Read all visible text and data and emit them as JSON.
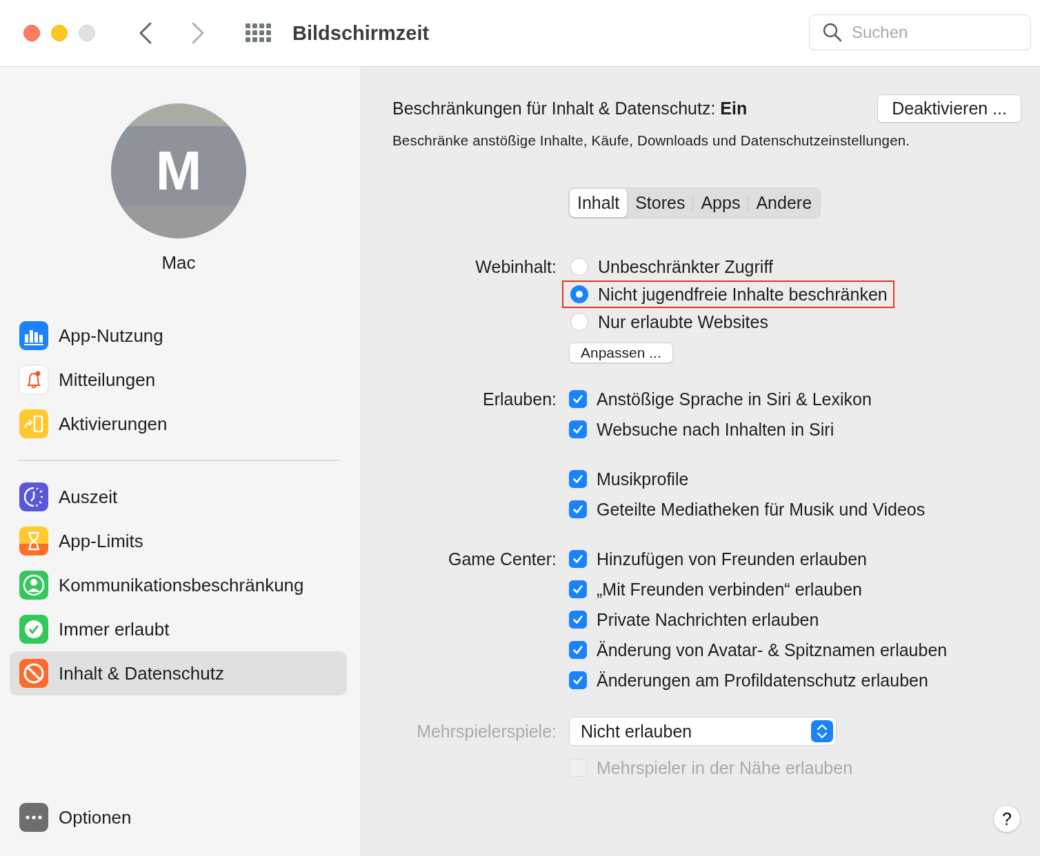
{
  "window": {
    "title": "Bildschirmzeit"
  },
  "search": {
    "placeholder": "Suchen"
  },
  "profile": {
    "initial": "M",
    "name": "Mac"
  },
  "sidebar": {
    "groups": [
      [
        {
          "label": "App-Nutzung",
          "selected": false
        },
        {
          "label": "Mitteilungen",
          "selected": false
        },
        {
          "label": "Aktivierungen",
          "selected": false
        }
      ],
      [
        {
          "label": "Auszeit",
          "selected": false
        },
        {
          "label": "App-Limits",
          "selected": false
        },
        {
          "label": "Kommunikationsbeschränkung",
          "selected": false
        },
        {
          "label": "Immer erlaubt",
          "selected": false
        },
        {
          "label": "Inhalt & Datenschutz",
          "selected": true
        }
      ]
    ],
    "options": {
      "label": "Optionen"
    }
  },
  "content": {
    "title": "Beschränkungen für Inhalt & Datenschutz: **Ein**",
    "deactivate_button": "Deaktivieren ...",
    "description": "Beschränke anstößige Inhalte, Käufe, Downloads und Datenschutzeinstellungen."
  },
  "tabs": [
    {
      "label": "Inhalt",
      "selected": true
    },
    {
      "label": "Stores",
      "selected": false
    },
    {
      "label": "Apps",
      "selected": false
    },
    {
      "label": "Andere",
      "selected": false
    }
  ],
  "web_content": {
    "label": "Webinhalt:",
    "options": [
      {
        "label": "Unbeschränkter Zugriff",
        "selected": false,
        "highlighted": false
      },
      {
        "label": "Nicht jugendfreie Inhalte beschränken",
        "selected": true,
        "highlighted": true
      },
      {
        "label": "Nur erlaubte Websites",
        "selected": false,
        "highlighted": false
      }
    ],
    "customize_button": "Anpassen ..."
  },
  "allow": {
    "label": "Erlauben:",
    "groups": [
      [
        {
          "label": "Anstößige Sprache in Siri & Lexikon",
          "checked": true
        },
        {
          "label": "Websuche nach Inhalten in Siri",
          "checked": true
        }
      ],
      [
        {
          "label": "Musikprofile",
          "checked": true
        },
        {
          "label": "Geteilte Mediatheken für Musik und Videos",
          "checked": true
        }
      ]
    ]
  },
  "game_center": {
    "label": "Game Center:",
    "options": [
      {
        "label": "Hinzufügen von Freunden erlauben",
        "checked": true
      },
      {
        "label": "„Mit Freunden verbinden“ erlauben",
        "checked": true
      },
      {
        "label": "Private Nachrichten erlauben",
        "checked": true
      },
      {
        "label": "Änderung von Avatar- & Spitznamen erlauben",
        "checked": true
      },
      {
        "label": "Änderungen am Profildatenschutz erlauben",
        "checked": true
      }
    ]
  },
  "multiplayer": {
    "label": "Mehrspielerspiele:",
    "value": "Nicht erlauben",
    "disabled": true
  },
  "nearby": {
    "label": "Mehrspieler in der Nähe erlauben",
    "checked": false,
    "disabled": true
  },
  "help_button": "?"
}
